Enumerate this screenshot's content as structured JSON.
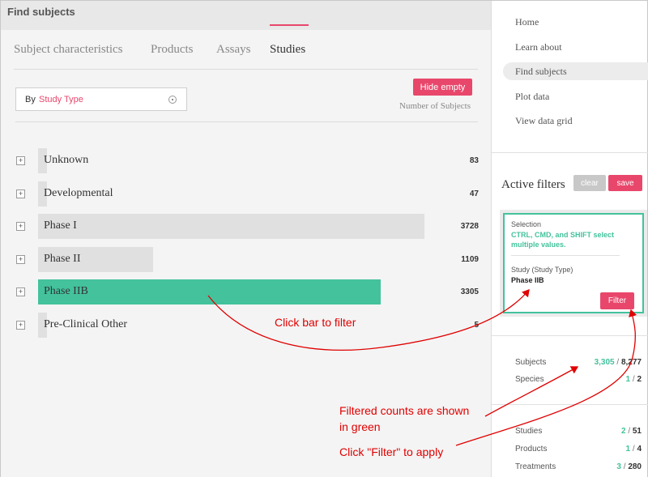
{
  "header": {
    "title": "Find subjects"
  },
  "tabs": [
    {
      "label": "Subject characteristics"
    },
    {
      "label": "Products"
    },
    {
      "label": "Assays"
    },
    {
      "label": "Studies"
    }
  ],
  "selector": {
    "by_label": "By",
    "value": "Study Type"
  },
  "hide_empty_label": "Hide empty",
  "count_header": "Number of Subjects",
  "expander_symbol": "+",
  "rows": [
    {
      "label": "Unknown",
      "count": 83
    },
    {
      "label": "Developmental",
      "count": 47
    },
    {
      "label": "Phase I",
      "count": 3728
    },
    {
      "label": "Phase II",
      "count": 1109
    },
    {
      "label": "Phase IIB",
      "count": 3305,
      "selected": true
    },
    {
      "label": "Pre-Clinical Other",
      "count": 5
    }
  ],
  "sidebar": {
    "nav": [
      {
        "label": "Home"
      },
      {
        "label": "Learn about"
      },
      {
        "label": "Find subjects",
        "active": true
      },
      {
        "label": "Plot data"
      },
      {
        "label": "View data grid"
      }
    ],
    "active_filters_title": "Active filters",
    "clear_label": "clear",
    "save_label": "save",
    "filter_card": {
      "selection_label": "Selection",
      "help_text": "CTRL, CMD, and SHIFT select multiple values.",
      "type_label": "Study (Study Type)",
      "value": "Phase IIB",
      "button_label": "Filter"
    },
    "stats_group1": [
      {
        "label": "Subjects",
        "filtered": "3,305",
        "total": "8,277"
      },
      {
        "label": "Species",
        "filtered": "1",
        "total": "2"
      }
    ],
    "stats_group2": [
      {
        "label": "Studies",
        "filtered": "2",
        "total": "51"
      },
      {
        "label": "Products",
        "filtered": "1",
        "total": "4"
      },
      {
        "label": "Treatments",
        "filtered": "3",
        "total": "280"
      }
    ],
    "slash": "/"
  },
  "annotations": {
    "click_bar": "Click bar to filter",
    "filtered_counts_line1": "Filtered counts are shown",
    "filtered_counts_line2": "in green",
    "click_filter": "Click \"Filter\" to apply"
  },
  "colors": {
    "accent": "#e8476b",
    "selected_bar": "#43c29c",
    "bar": "#e0e0e0",
    "annotation": "#e00000"
  }
}
